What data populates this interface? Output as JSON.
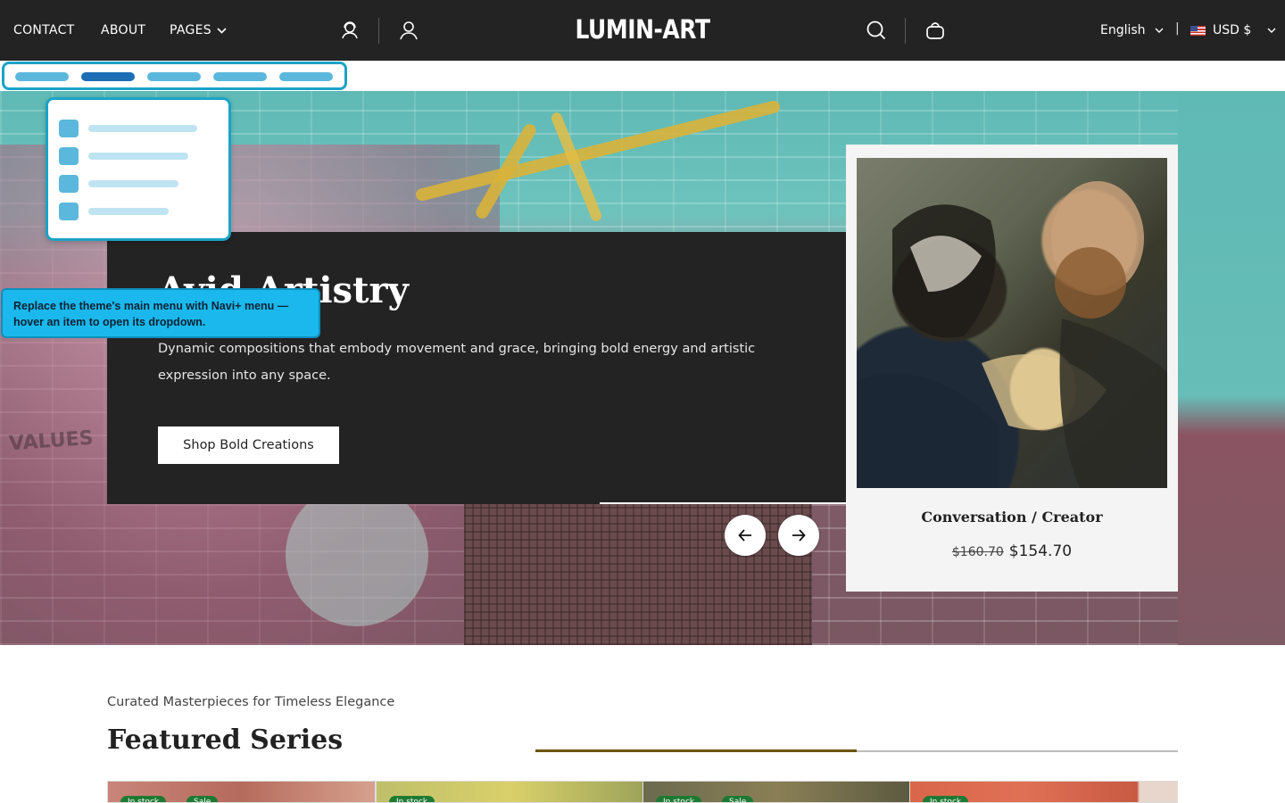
{
  "header": {
    "nav": {
      "contact": "CONTACT",
      "about": "ABOUT",
      "pages": "PAGES"
    },
    "logo": "LUMIN-ART",
    "language": "English",
    "separator": "|",
    "currency": "USD $",
    "icons": [
      "chevron-down-icon",
      "support-agent-icon",
      "user-icon",
      "search-icon",
      "bag-icon",
      "flag-us-icon"
    ]
  },
  "overlay": {
    "tooltip": "Replace the theme's main menu with Navi+ menu — hover an item to open its dropdown."
  },
  "hero": {
    "title": "Avid Artistry",
    "description": "Dynamic compositions that embody movement and grace, bringing bold energy and artistic expression into any space.",
    "button": "Shop Bold Creations",
    "wall_text": "VALUES",
    "product": {
      "name": "Conversation / Creator",
      "old_price": "$160.70",
      "price": "$154.70"
    }
  },
  "featured": {
    "subtitle": "Curated Masterpieces for Timeless Elegance",
    "title": "Featured Series",
    "badges": [
      "In stock",
      "Sale"
    ]
  },
  "colors": {
    "header_bg": "#232323",
    "accent_gold": "#6d5208",
    "overlay_blue": "#1aa3c7",
    "tooltip_bg": "#1ab8ec",
    "badge_green": "#1e7a33"
  }
}
